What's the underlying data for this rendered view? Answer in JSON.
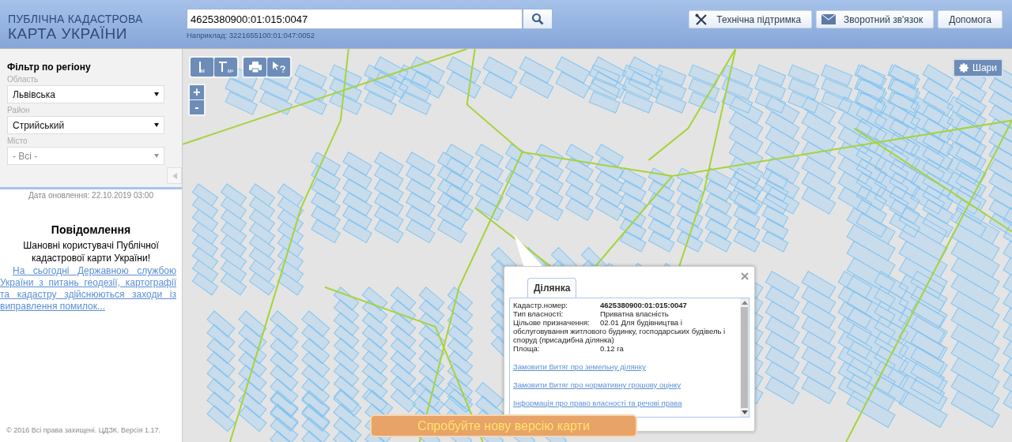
{
  "header": {
    "logo_line_1": "ПУБЛІЧНА КАДАСТРОВА",
    "logo_line_2": "КАРТА УКРАЇНИ",
    "search": {
      "value": "4625380900:01:015:0047",
      "hint": "Наприклад: 3221655100:01:047:0052"
    },
    "buttons": [
      {
        "kind": "tools",
        "label": "Технічна підтримка"
      },
      {
        "kind": "mail",
        "label": "Зворотний зв'язок"
      },
      {
        "kind": "plain",
        "label": "Допомога"
      }
    ]
  },
  "sidebar": {
    "filter_title": "Фільтр по регіону",
    "filters": [
      {
        "label": "Область",
        "value": "Львівська",
        "disabled": false
      },
      {
        "label": "Район",
        "value": "Стрийський",
        "disabled": false
      },
      {
        "label": "Місто",
        "value": "- Всі -",
        "disabled": true
      }
    ],
    "updated": "Дата оновлення: 22.10.2019 03:00",
    "notice_title": "Повідомлення",
    "notice_greeting": "Шановні користувачі Публічної кадастрової карти України!",
    "notice_link": "На сьогодні Державною службою України з питань геодезії, картографії та кадастру здійснюються заходи із виправлення помилок...",
    "copyright": "© 2016 Всі права захищені. ЦДЗК. Версія 1.17."
  },
  "map": {
    "tools": [
      {
        "kind": "distance",
        "unit": "м"
      },
      {
        "kind": "area",
        "unit": "м²"
      },
      {
        "kind": "print"
      },
      {
        "kind": "identify"
      }
    ],
    "zoom_in": "+",
    "zoom_out": "-",
    "layers_button": "Шари",
    "popup": {
      "tabs": [
        {
          "label": "Ділянка",
          "selected": true
        }
      ],
      "fields": [
        {
          "label": "Кадастр.номер:",
          "value": "4625380900:01:015:0047",
          "emphasis": true
        },
        {
          "label": "Тип власності:",
          "value": "Приватна власність",
          "emphasis": false
        },
        {
          "label": "Цільове призначення:",
          "value": "02.01 Для будівництва і обслуговування житлового будинку, господарських будівель і споруд (присадибна ділянка)",
          "emphasis": false
        },
        {
          "label": "Площа:",
          "value": "0.12 га",
          "emphasis": false
        }
      ],
      "links": [
        "Замовити Витяг про земельну ділянку",
        "Замовити Витяг про нормативну грошову оцінку",
        "Інформація про право власності та речові права"
      ]
    },
    "banner": "Спробуйте нову версію карти"
  }
}
